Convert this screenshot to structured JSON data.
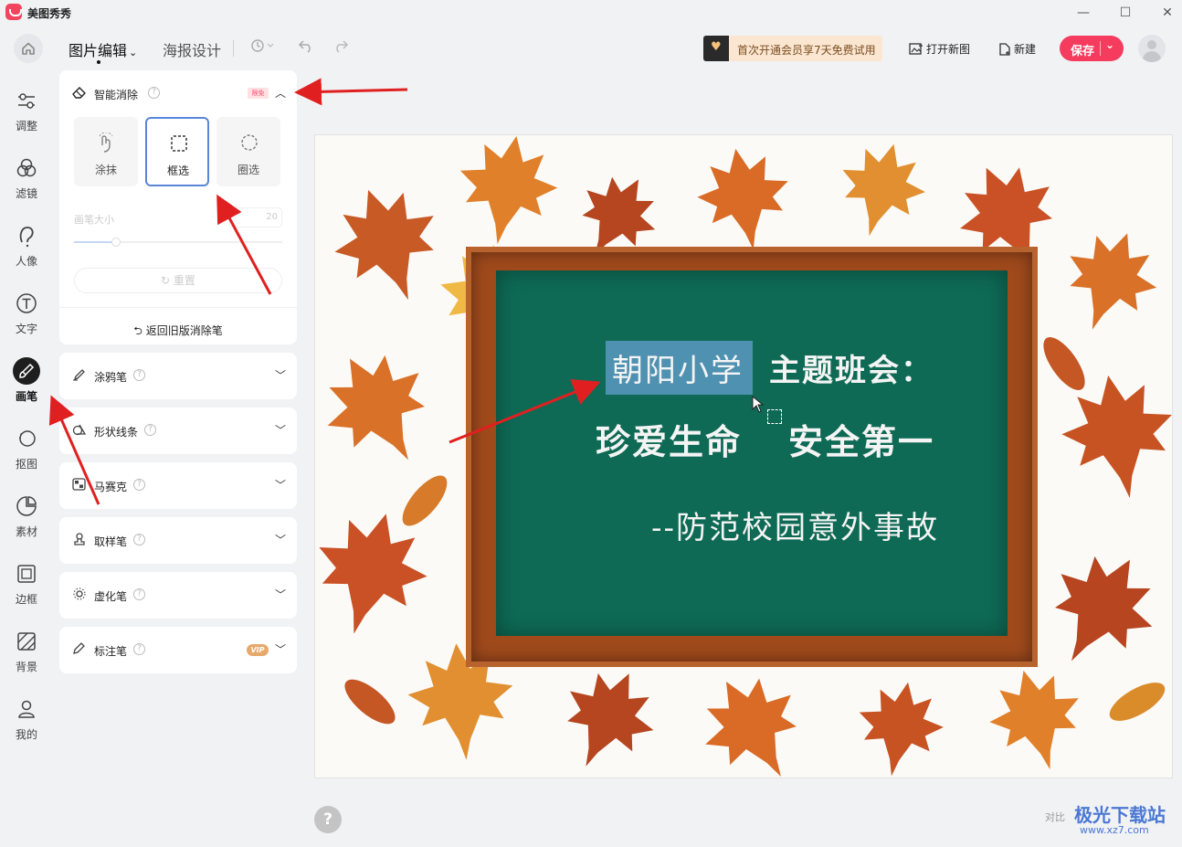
{
  "app": {
    "title": "美图秀秀"
  },
  "window": {
    "minimize": "—",
    "maximize": "☐",
    "close": "✕"
  },
  "header": {
    "tabs": [
      {
        "label": "图片编辑",
        "active": true
      },
      {
        "label": "海报设计",
        "active": false
      }
    ],
    "vip_banner": "首次开通会员享7天免费试用",
    "open_new": "打开新图",
    "new": "新建",
    "save": "保存"
  },
  "nav": {
    "items": [
      {
        "label": "调整",
        "icon": "sliders-icon"
      },
      {
        "label": "滤镜",
        "icon": "filter-circles-icon"
      },
      {
        "label": "人像",
        "icon": "portrait-icon"
      },
      {
        "label": "文字",
        "icon": "text-icon"
      },
      {
        "label": "画笔",
        "icon": "brush-icon",
        "active": true
      },
      {
        "label": "抠图",
        "icon": "cutout-icon"
      },
      {
        "label": "素材",
        "icon": "sticker-icon"
      },
      {
        "label": "边框",
        "icon": "frame-icon"
      },
      {
        "label": "背景",
        "icon": "background-icon"
      },
      {
        "label": "我的",
        "icon": "user-icon"
      }
    ]
  },
  "panel": {
    "smart_erase": {
      "title": "智能消除",
      "free_tag": "限免",
      "modes": [
        {
          "label": "涂抹",
          "icon": "smear-icon"
        },
        {
          "label": "框选",
          "icon": "rect-select-icon",
          "selected": true
        },
        {
          "label": "圈选",
          "icon": "lasso-icon"
        }
      ],
      "brush_size_label": "画笔大小",
      "brush_size_value": "20",
      "brush_size_fraction": 0.2,
      "reset": "重置",
      "old_eraser": "返回旧版消除笔"
    },
    "sections": [
      {
        "label": "涂鸦笔",
        "icon": "doodle-pen-icon"
      },
      {
        "label": "形状线条",
        "icon": "shape-line-icon"
      },
      {
        "label": "马赛克",
        "icon": "mosaic-icon"
      },
      {
        "label": "取样笔",
        "icon": "sample-pen-icon"
      },
      {
        "label": "虚化笔",
        "icon": "blur-pen-icon"
      },
      {
        "label": "标注笔",
        "icon": "annotate-pen-icon",
        "tag": "VIP"
      }
    ]
  },
  "canvas": {
    "lines": [
      {
        "text": "朝阳小学"
      },
      {
        "text": "主题班会："
      },
      {
        "text": "珍爱生命"
      },
      {
        "text": "安全第一"
      },
      {
        "text": "--防范校园意外事故"
      }
    ]
  },
  "watermark": {
    "brand": "极光下载站",
    "url": "www.xz7.com",
    "compare": "对比"
  },
  "colors": {
    "accent": "#f53b5e",
    "selected_border": "#5a86d8",
    "chalkboard": "#0e6a55",
    "arrow": "#e02020"
  }
}
